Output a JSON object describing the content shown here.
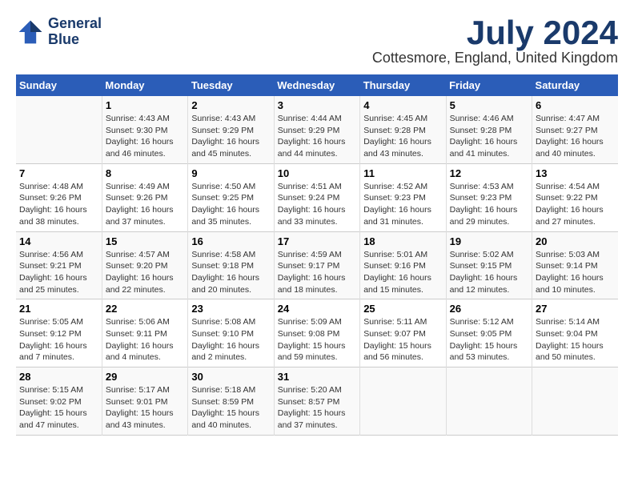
{
  "logo": {
    "line1": "General",
    "line2": "Blue"
  },
  "title": "July 2024",
  "location": "Cottesmore, England, United Kingdom",
  "headers": [
    "Sunday",
    "Monday",
    "Tuesday",
    "Wednesday",
    "Thursday",
    "Friday",
    "Saturday"
  ],
  "weeks": [
    [
      {
        "day": "",
        "info": ""
      },
      {
        "day": "1",
        "info": "Sunrise: 4:43 AM\nSunset: 9:30 PM\nDaylight: 16 hours\nand 46 minutes."
      },
      {
        "day": "2",
        "info": "Sunrise: 4:43 AM\nSunset: 9:29 PM\nDaylight: 16 hours\nand 45 minutes."
      },
      {
        "day": "3",
        "info": "Sunrise: 4:44 AM\nSunset: 9:29 PM\nDaylight: 16 hours\nand 44 minutes."
      },
      {
        "day": "4",
        "info": "Sunrise: 4:45 AM\nSunset: 9:28 PM\nDaylight: 16 hours\nand 43 minutes."
      },
      {
        "day": "5",
        "info": "Sunrise: 4:46 AM\nSunset: 9:28 PM\nDaylight: 16 hours\nand 41 minutes."
      },
      {
        "day": "6",
        "info": "Sunrise: 4:47 AM\nSunset: 9:27 PM\nDaylight: 16 hours\nand 40 minutes."
      }
    ],
    [
      {
        "day": "7",
        "info": "Sunrise: 4:48 AM\nSunset: 9:26 PM\nDaylight: 16 hours\nand 38 minutes."
      },
      {
        "day": "8",
        "info": "Sunrise: 4:49 AM\nSunset: 9:26 PM\nDaylight: 16 hours\nand 37 minutes."
      },
      {
        "day": "9",
        "info": "Sunrise: 4:50 AM\nSunset: 9:25 PM\nDaylight: 16 hours\nand 35 minutes."
      },
      {
        "day": "10",
        "info": "Sunrise: 4:51 AM\nSunset: 9:24 PM\nDaylight: 16 hours\nand 33 minutes."
      },
      {
        "day": "11",
        "info": "Sunrise: 4:52 AM\nSunset: 9:23 PM\nDaylight: 16 hours\nand 31 minutes."
      },
      {
        "day": "12",
        "info": "Sunrise: 4:53 AM\nSunset: 9:23 PM\nDaylight: 16 hours\nand 29 minutes."
      },
      {
        "day": "13",
        "info": "Sunrise: 4:54 AM\nSunset: 9:22 PM\nDaylight: 16 hours\nand 27 minutes."
      }
    ],
    [
      {
        "day": "14",
        "info": "Sunrise: 4:56 AM\nSunset: 9:21 PM\nDaylight: 16 hours\nand 25 minutes."
      },
      {
        "day": "15",
        "info": "Sunrise: 4:57 AM\nSunset: 9:20 PM\nDaylight: 16 hours\nand 22 minutes."
      },
      {
        "day": "16",
        "info": "Sunrise: 4:58 AM\nSunset: 9:18 PM\nDaylight: 16 hours\nand 20 minutes."
      },
      {
        "day": "17",
        "info": "Sunrise: 4:59 AM\nSunset: 9:17 PM\nDaylight: 16 hours\nand 18 minutes."
      },
      {
        "day": "18",
        "info": "Sunrise: 5:01 AM\nSunset: 9:16 PM\nDaylight: 16 hours\nand 15 minutes."
      },
      {
        "day": "19",
        "info": "Sunrise: 5:02 AM\nSunset: 9:15 PM\nDaylight: 16 hours\nand 12 minutes."
      },
      {
        "day": "20",
        "info": "Sunrise: 5:03 AM\nSunset: 9:14 PM\nDaylight: 16 hours\nand 10 minutes."
      }
    ],
    [
      {
        "day": "21",
        "info": "Sunrise: 5:05 AM\nSunset: 9:12 PM\nDaylight: 16 hours\nand 7 minutes."
      },
      {
        "day": "22",
        "info": "Sunrise: 5:06 AM\nSunset: 9:11 PM\nDaylight: 16 hours\nand 4 minutes."
      },
      {
        "day": "23",
        "info": "Sunrise: 5:08 AM\nSunset: 9:10 PM\nDaylight: 16 hours\nand 2 minutes."
      },
      {
        "day": "24",
        "info": "Sunrise: 5:09 AM\nSunset: 9:08 PM\nDaylight: 15 hours\nand 59 minutes."
      },
      {
        "day": "25",
        "info": "Sunrise: 5:11 AM\nSunset: 9:07 PM\nDaylight: 15 hours\nand 56 minutes."
      },
      {
        "day": "26",
        "info": "Sunrise: 5:12 AM\nSunset: 9:05 PM\nDaylight: 15 hours\nand 53 minutes."
      },
      {
        "day": "27",
        "info": "Sunrise: 5:14 AM\nSunset: 9:04 PM\nDaylight: 15 hours\nand 50 minutes."
      }
    ],
    [
      {
        "day": "28",
        "info": "Sunrise: 5:15 AM\nSunset: 9:02 PM\nDaylight: 15 hours\nand 47 minutes."
      },
      {
        "day": "29",
        "info": "Sunrise: 5:17 AM\nSunset: 9:01 PM\nDaylight: 15 hours\nand 43 minutes."
      },
      {
        "day": "30",
        "info": "Sunrise: 5:18 AM\nSunset: 8:59 PM\nDaylight: 15 hours\nand 40 minutes."
      },
      {
        "day": "31",
        "info": "Sunrise: 5:20 AM\nSunset: 8:57 PM\nDaylight: 15 hours\nand 37 minutes."
      },
      {
        "day": "",
        "info": ""
      },
      {
        "day": "",
        "info": ""
      },
      {
        "day": "",
        "info": ""
      }
    ]
  ]
}
